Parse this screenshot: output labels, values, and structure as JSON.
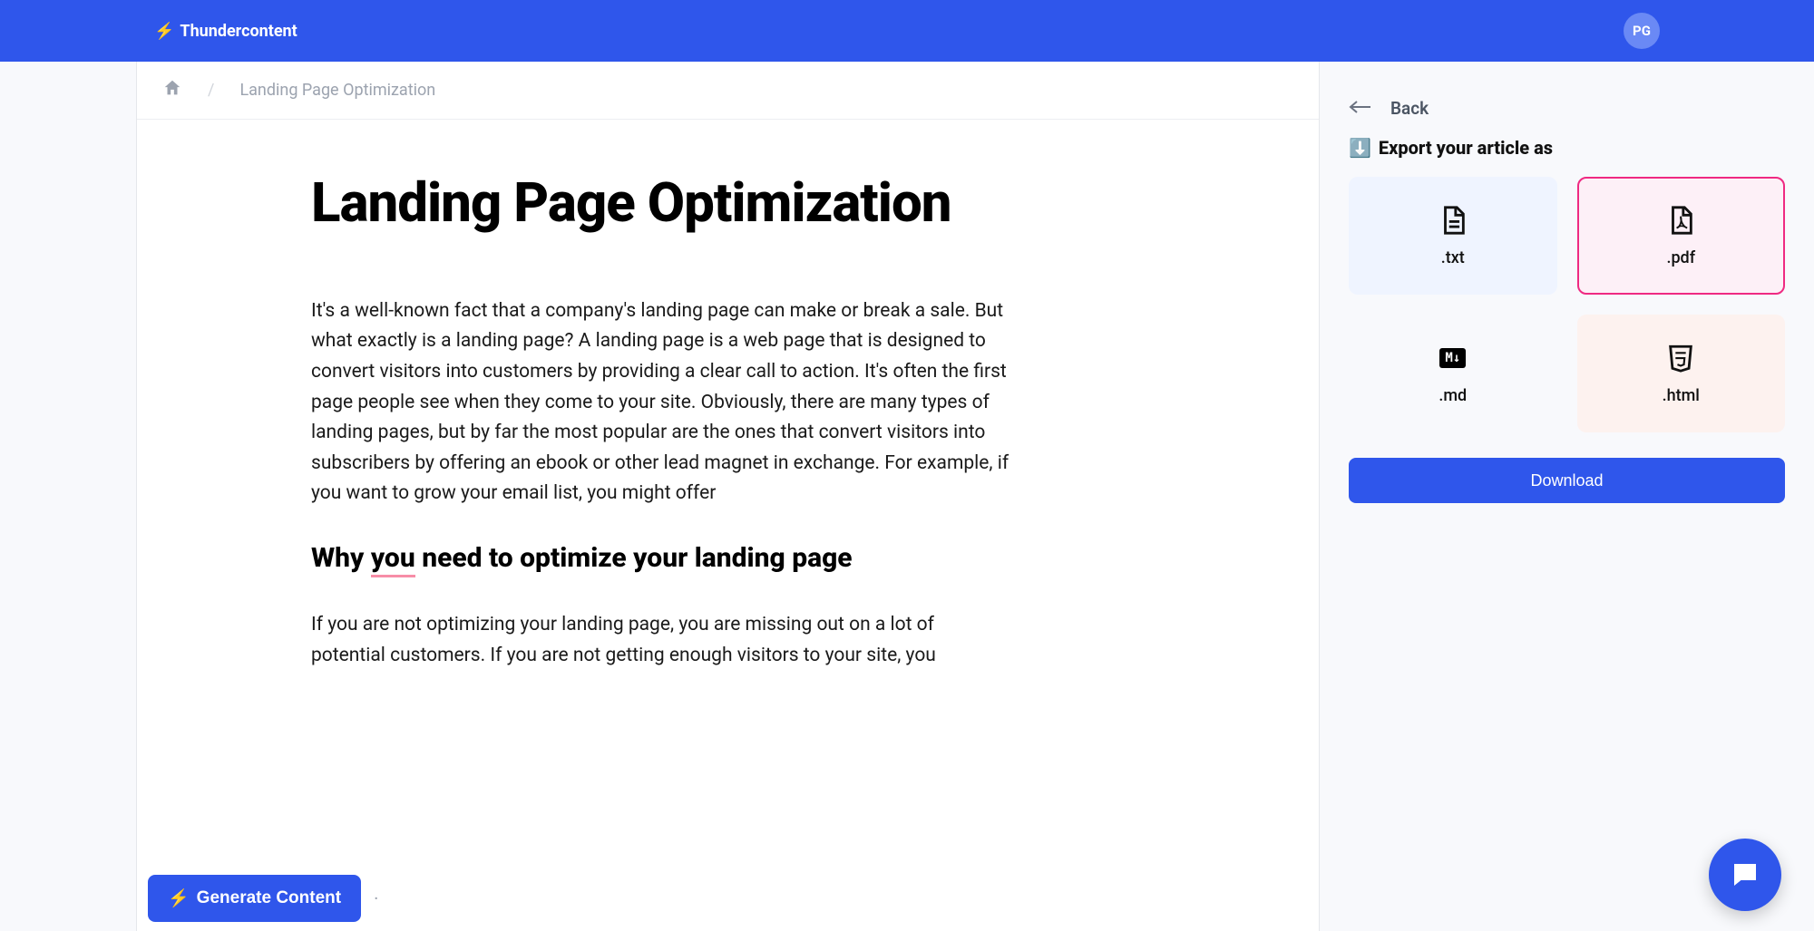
{
  "header": {
    "brand": "Thundercontent",
    "avatar": "PG"
  },
  "breadcrumb": {
    "current": "Landing Page Optimization"
  },
  "article": {
    "title": "Landing Page Optimization",
    "p1": "It's a well-known fact that a company's landing page can make or break a sale. But what exactly is a landing page?  A landing page is a web page that is designed to convert visitors into customers by providing a clear call to action. It's often the first page people see when they come to your site. Obviously, there are many types of landing pages, but by far the most popular are the ones that convert visitors into subscribers by offering an ebook or other lead magnet in exchange. For example, if you want to grow your email list, you might offer",
    "h2_pre": "Why ",
    "h2_underline": "you",
    "h2_post": " need to optimize your landing page",
    "p2": "If you are not optimizing your landing page, you are missing out on a lot of potential customers. If you are not getting enough visitors to your site, you"
  },
  "generate": {
    "label": "Generate Content"
  },
  "sidebar": {
    "back": "Back",
    "export_title": "Export your article as",
    "cards": {
      "txt": ".txt",
      "pdf": ".pdf",
      "md": ".md",
      "html": ".html"
    },
    "download": "Download"
  }
}
